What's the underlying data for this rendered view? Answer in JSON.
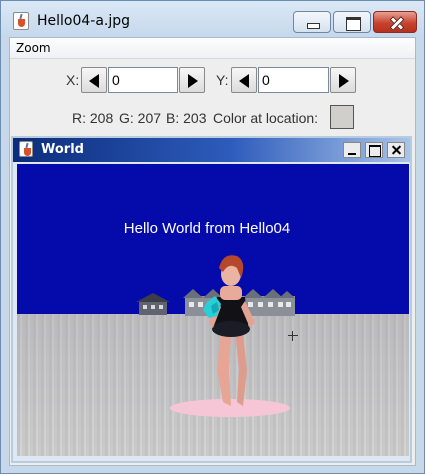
{
  "window": {
    "title": "Hello04-a.jpg",
    "icon": "java-cup-icon"
  },
  "menu": {
    "items": [
      "Zoom"
    ]
  },
  "controls": {
    "x_label": "X:",
    "x_value": "0",
    "y_label": "Y:",
    "y_value": "0"
  },
  "pixel": {
    "r_label": "R: 208",
    "g_label": "G: 207",
    "b_label": "B: 203",
    "color_label": "Color at location:",
    "color": "#d0cfcb"
  },
  "inner_window": {
    "title": "World",
    "icon": "java-cup-icon"
  },
  "scene": {
    "text": "Hello World from Hello04",
    "sky_color": "#050bab",
    "floor_color": "#cccccc"
  }
}
